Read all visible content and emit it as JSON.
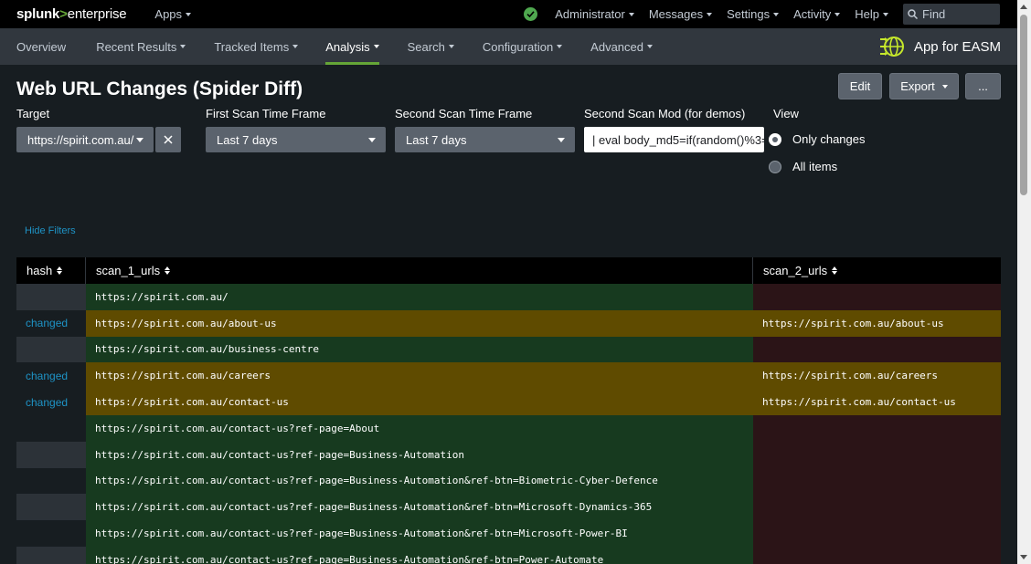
{
  "topbar": {
    "logo_main": "splunk",
    "logo_gt": ">",
    "logo_sub": "enterprise",
    "apps_label": "Apps",
    "menu": [
      "Administrator",
      "Messages",
      "Settings",
      "Activity",
      "Help"
    ],
    "find_placeholder": "Find",
    "status_color": "#4fa84f"
  },
  "appbar": {
    "nav": [
      "Overview",
      "Recent Results",
      "Tracked Items",
      "Analysis",
      "Search",
      "Configuration",
      "Advanced"
    ],
    "nav_has_caret": [
      false,
      true,
      true,
      true,
      true,
      true,
      true
    ],
    "active": "Analysis",
    "app_name": "App for EASM",
    "accent": "#65a637"
  },
  "page": {
    "title": "Web URL Changes (Spider Diff)",
    "buttons": {
      "edit": "Edit",
      "export": "Export",
      "more": "..."
    }
  },
  "filters": {
    "target": {
      "label": "Target",
      "value": "https://spirit.com.au/"
    },
    "first_scan": {
      "label": "First Scan Time Frame",
      "value": "Last 7 days"
    },
    "second_scan": {
      "label": "Second Scan Time Frame",
      "value": "Last 7 days"
    },
    "second_scan_mod": {
      "label": "Second Scan Mod (for demos)",
      "value": "| eval body_md5=if(random()%3="
    },
    "view": {
      "label": "View",
      "options": [
        "Only changes",
        "All items"
      ],
      "selected": "Only changes"
    },
    "hide_filters": "Hide Filters"
  },
  "table": {
    "headers": [
      "hash",
      "scan_1_urls",
      "scan_2_urls"
    ],
    "rows": [
      {
        "hash": "",
        "scan_1": "https://spirit.com.au/",
        "scan_2": "",
        "status": "added"
      },
      {
        "hash": "changed",
        "scan_1": "https://spirit.com.au/about-us",
        "scan_2": "https://spirit.com.au/about-us",
        "status": "changed"
      },
      {
        "hash": "",
        "scan_1": "https://spirit.com.au/business-centre",
        "scan_2": "",
        "status": "added"
      },
      {
        "hash": "changed",
        "scan_1": "https://spirit.com.au/careers",
        "scan_2": "https://spirit.com.au/careers",
        "status": "changed"
      },
      {
        "hash": "changed",
        "scan_1": "https://spirit.com.au/contact-us",
        "scan_2": "https://spirit.com.au/contact-us",
        "status": "changed"
      },
      {
        "hash": "",
        "scan_1": "https://spirit.com.au/contact-us?ref-page=About",
        "scan_2": "",
        "status": "added"
      },
      {
        "hash": "",
        "scan_1": "https://spirit.com.au/contact-us?ref-page=Business-Automation",
        "scan_2": "",
        "status": "added"
      },
      {
        "hash": "",
        "scan_1": "https://spirit.com.au/contact-us?ref-page=Business-Automation&ref-btn=Biometric-Cyber-Defence",
        "scan_2": "",
        "status": "added"
      },
      {
        "hash": "",
        "scan_1": "https://spirit.com.au/contact-us?ref-page=Business-Automation&ref-btn=Microsoft-Dynamics-365",
        "scan_2": "",
        "status": "added"
      },
      {
        "hash": "",
        "scan_1": "https://spirit.com.au/contact-us?ref-page=Business-Automation&ref-btn=Microsoft-Power-BI",
        "scan_2": "",
        "status": "added"
      },
      {
        "hash": "",
        "scan_1": "https://spirit.com.au/contact-us?ref-page=Business-Automation&ref-btn=Power-Automate",
        "scan_2": "",
        "status": "added"
      }
    ],
    "colors": {
      "added": "#173a1f",
      "removed": "#2b1417",
      "changed": "#5f4b00"
    }
  }
}
